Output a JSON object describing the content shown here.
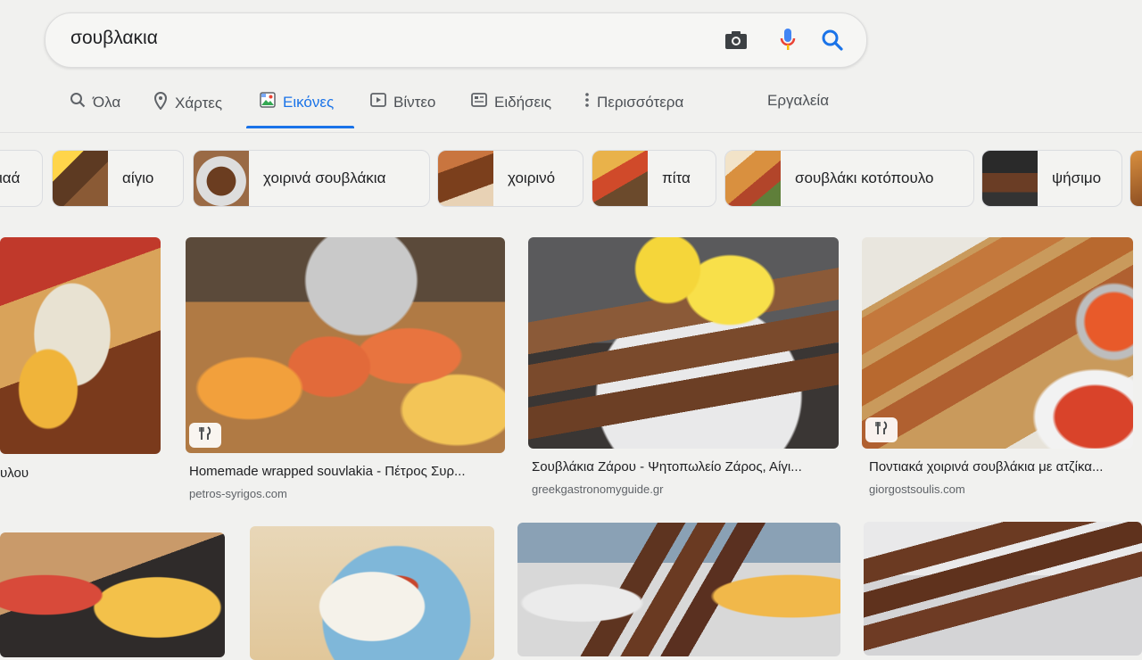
{
  "search": {
    "query": "σουβλακια",
    "icons": [
      "camera-icon",
      "mic-icon",
      "search-icon"
    ]
  },
  "tabs": [
    {
      "label": "Όλα",
      "icon": "search-icon"
    },
    {
      "label": "Χάρτες",
      "icon": "map-pin-icon"
    },
    {
      "label": "Εικόνες",
      "icon": "image-icon",
      "active": true
    },
    {
      "label": "Βίντεο",
      "icon": "play-icon"
    },
    {
      "label": "Ειδήσεις",
      "icon": "news-icon"
    },
    {
      "label": "Περισσότερα",
      "icon": "more-vert-icon"
    }
  ],
  "tools_label": "Εργαλεία",
  "chips": [
    {
      "label": "ιαά"
    },
    {
      "label": "αίγιο"
    },
    {
      "label": "χοιρινά σουβλάκια"
    },
    {
      "label": "χοιρινό"
    },
    {
      "label": "πίτα"
    },
    {
      "label": "σουβλάκι κοτόπουλο"
    },
    {
      "label": "ψήσιμο"
    }
  ],
  "results": [
    {
      "title": "υλου",
      "source": "",
      "badge": false
    },
    {
      "title": "Homemade wrapped souvlakia - Πέτρος Συρ...",
      "source": "petros-syrigos.com",
      "badge": true
    },
    {
      "title": "Σουβλάκια Ζάρου - Ψητοπωλείο Ζάρος, Αίγι...",
      "source": "greekgastronomyguide.gr",
      "badge": false
    },
    {
      "title": "Ποντιακά χοιρινά σουβλάκια με ατζίκα...",
      "source": "giorgostsoulis.com",
      "badge": true
    }
  ],
  "colors": {
    "accent": "#1a73e8",
    "mic_red": "#ea4335",
    "mic_yellow": "#fbbc04"
  }
}
